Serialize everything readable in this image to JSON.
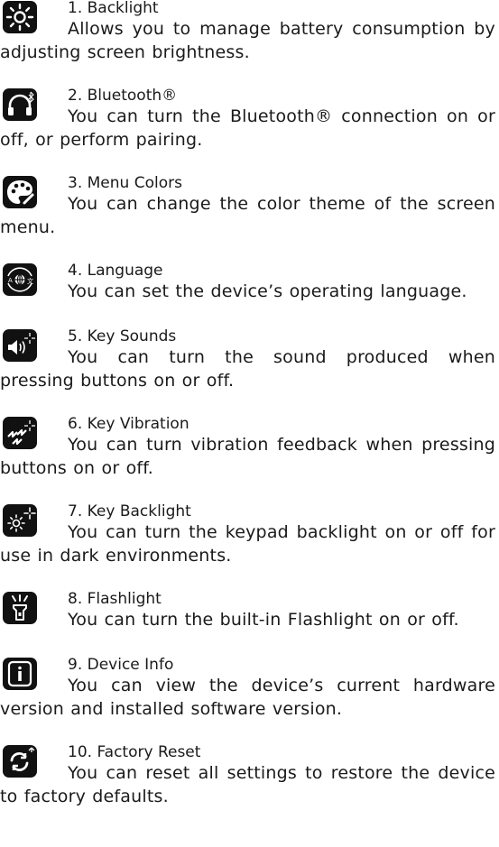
{
  "entries": [
    {
      "title": "1. Backlight",
      "text": "Allows you to manage battery consumption by adjusting screen brightness.",
      "icon": "backlight-icon"
    },
    {
      "title": "2. Bluetooth®",
      "text": "You can turn the Bluetooth® connection on or off, or perform pairing.",
      "icon": "bluetooth-headphones-icon"
    },
    {
      "title": "3. Menu Colors",
      "text": "You can change the color theme of the screen menu.",
      "icon": "palette-icon"
    },
    {
      "title": "4. Language",
      "text": "You can set the device’s operating language.",
      "icon": "language-globe-icon"
    },
    {
      "title": "5. Key Sounds",
      "text": "You can turn the sound produced when pressing buttons on or off.",
      "icon": "speaker-icon"
    },
    {
      "title": "6. Key Vibration",
      "text": "You can turn vibration feedback when pressing buttons on or off.",
      "icon": "vibration-icon"
    },
    {
      "title": "7. Key Backlight",
      "text": "You can turn the keypad backlight on or off for use in dark environments.",
      "icon": "key-backlight-icon"
    },
    {
      "title": "8. Flashlight",
      "text": "You can turn the built-in Flashlight on or off.",
      "icon": "flashlight-icon"
    },
    {
      "title": "9. Device Info",
      "text": "You can view the device’s current hardware version and installed software version.",
      "icon": "info-icon"
    },
    {
      "title": "10. Factory Reset",
      "text": "You can reset all settings to restore the device to factory defaults.",
      "icon": "factory-reset-icon"
    }
  ]
}
